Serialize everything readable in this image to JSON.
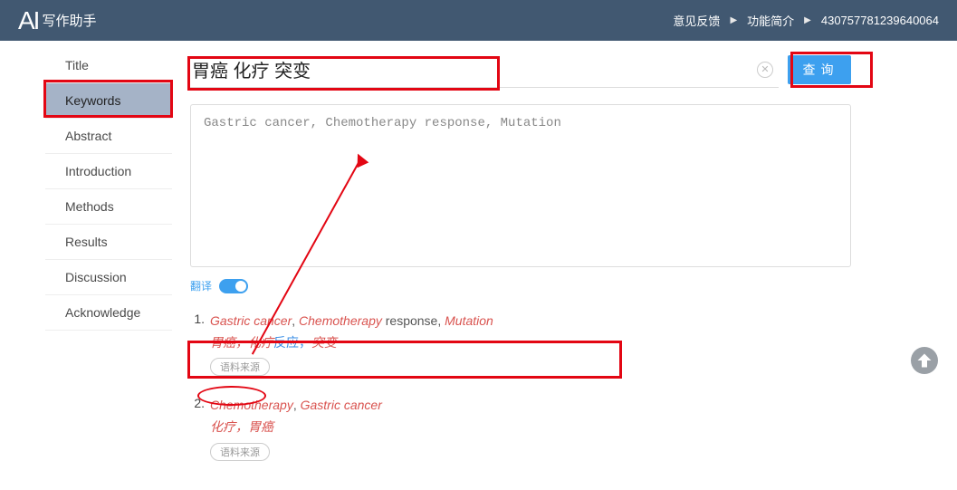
{
  "header": {
    "logo_ai": "AI",
    "logo_text": "写作助手",
    "links": {
      "feedback": "意见反馈",
      "features": "功能简介",
      "userid": "430757781239640064"
    }
  },
  "sidebar": {
    "items": [
      "Title",
      "Keywords",
      "Abstract",
      "Introduction",
      "Methods",
      "Results",
      "Discussion",
      "Acknowledge"
    ],
    "active_index": 1
  },
  "query": {
    "value": "胃癌 化疗 突变",
    "button": "查询"
  },
  "result_text": "Gastric cancer, Chemotherapy response, Mutation",
  "translate": {
    "label": "翻译",
    "on": true
  },
  "results": [
    {
      "num": "1.",
      "en_parts": [
        {
          "t": "Gastric cancer",
          "hl": true
        },
        {
          "t": ", ",
          "hl": false,
          "plain": true
        },
        {
          "t": "Chemotherapy",
          "hl": true
        },
        {
          "t": " response",
          "hl": false,
          "plain": true
        },
        {
          "t": ", ",
          "hl": false,
          "plain": true
        },
        {
          "t": "Mutation",
          "hl": true
        }
      ],
      "zh_parts": [
        {
          "t": "胃癌",
          "hl": true
        },
        {
          "t": "，",
          "hl": true
        },
        {
          "t": "化疗",
          "hl": true
        },
        {
          "t": "反应，",
          "hl": false
        },
        {
          "t": "突变",
          "hl": true
        }
      ],
      "source_btn": "语料来源"
    },
    {
      "num": "2.",
      "en_parts": [
        {
          "t": "Chemotherapy",
          "hl": true
        },
        {
          "t": ", ",
          "hl": false,
          "plain": true
        },
        {
          "t": "Gastric cancer",
          "hl": true
        }
      ],
      "zh_parts": [
        {
          "t": "化疗",
          "hl": true
        },
        {
          "t": "，",
          "hl": true
        },
        {
          "t": "胃癌",
          "hl": true
        }
      ],
      "source_btn": "语料来源"
    }
  ]
}
